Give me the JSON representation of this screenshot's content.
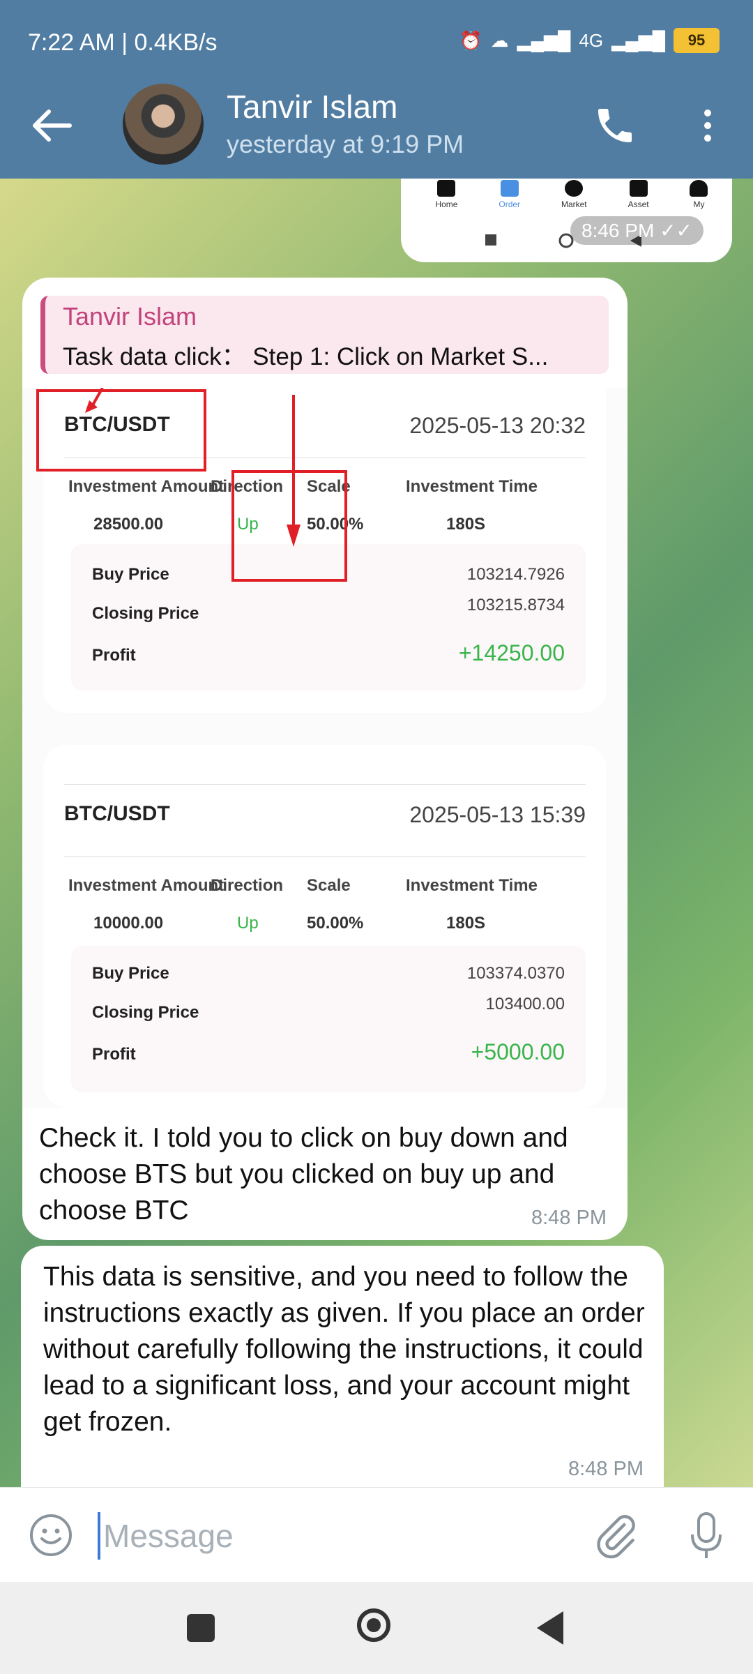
{
  "status_bar": {
    "time": "7:22 AM | 0.4KB/s",
    "network": "4G",
    "battery": "95"
  },
  "header": {
    "contact_name": "Tanvir Islam",
    "last_seen": "yesterday at 9:19 PM"
  },
  "image_top": {
    "nav": [
      {
        "label": "Home"
      },
      {
        "label": "Order"
      },
      {
        "label": "Market"
      },
      {
        "label": "Asset"
      },
      {
        "label": "My"
      }
    ],
    "time": "8:46 PM"
  },
  "message1": {
    "reply": {
      "name": "Tanvir Islam",
      "text": "Task data click：  Step 1: Click on Market S..."
    },
    "orders": [
      {
        "pair": "BTC/USDT",
        "datetime": "2025-05-13 20:32",
        "headers": [
          "Investment Amount",
          "Direction",
          "Scale",
          "Investment Time"
        ],
        "values": [
          "28500.00",
          "Up",
          "50.00%",
          "180S"
        ],
        "buy_label": "Buy Price",
        "buy_price": "103214.7926",
        "closing_label": "Closing Price",
        "closing_price": "103215.8734",
        "profit_label": "Profit",
        "profit": "+14250.00"
      },
      {
        "pair": "BTC/USDT",
        "datetime": "2025-05-13 15:39",
        "headers": [
          "Investment Amount",
          "Direction",
          "Scale",
          "Investment Time"
        ],
        "values": [
          "10000.00",
          "Up",
          "50.00%",
          "180S"
        ],
        "buy_label": "Buy Price",
        "buy_price": "103374.0370",
        "closing_label": "Closing Price",
        "closing_price": "103400.00",
        "profit_label": "Profit",
        "profit": "+5000.00"
      }
    ],
    "text": "Check it. I told you to click on buy down and choose BTS but you clicked on buy up and choose BTC",
    "time": "8:48 PM"
  },
  "message2": {
    "text": "This data is sensitive, and you need to follow the instructions exactly as given. If you place an order without carefully following the instructions, it could lead to a significant loss, and your account might get frozen.",
    "time": "8:48 PM"
  },
  "input": {
    "placeholder": "Message"
  },
  "colors": {
    "header": "#517da2",
    "profit_green": "#39b54a",
    "annotation_red": "#e01f26",
    "reply_pink": "#c2437b"
  }
}
